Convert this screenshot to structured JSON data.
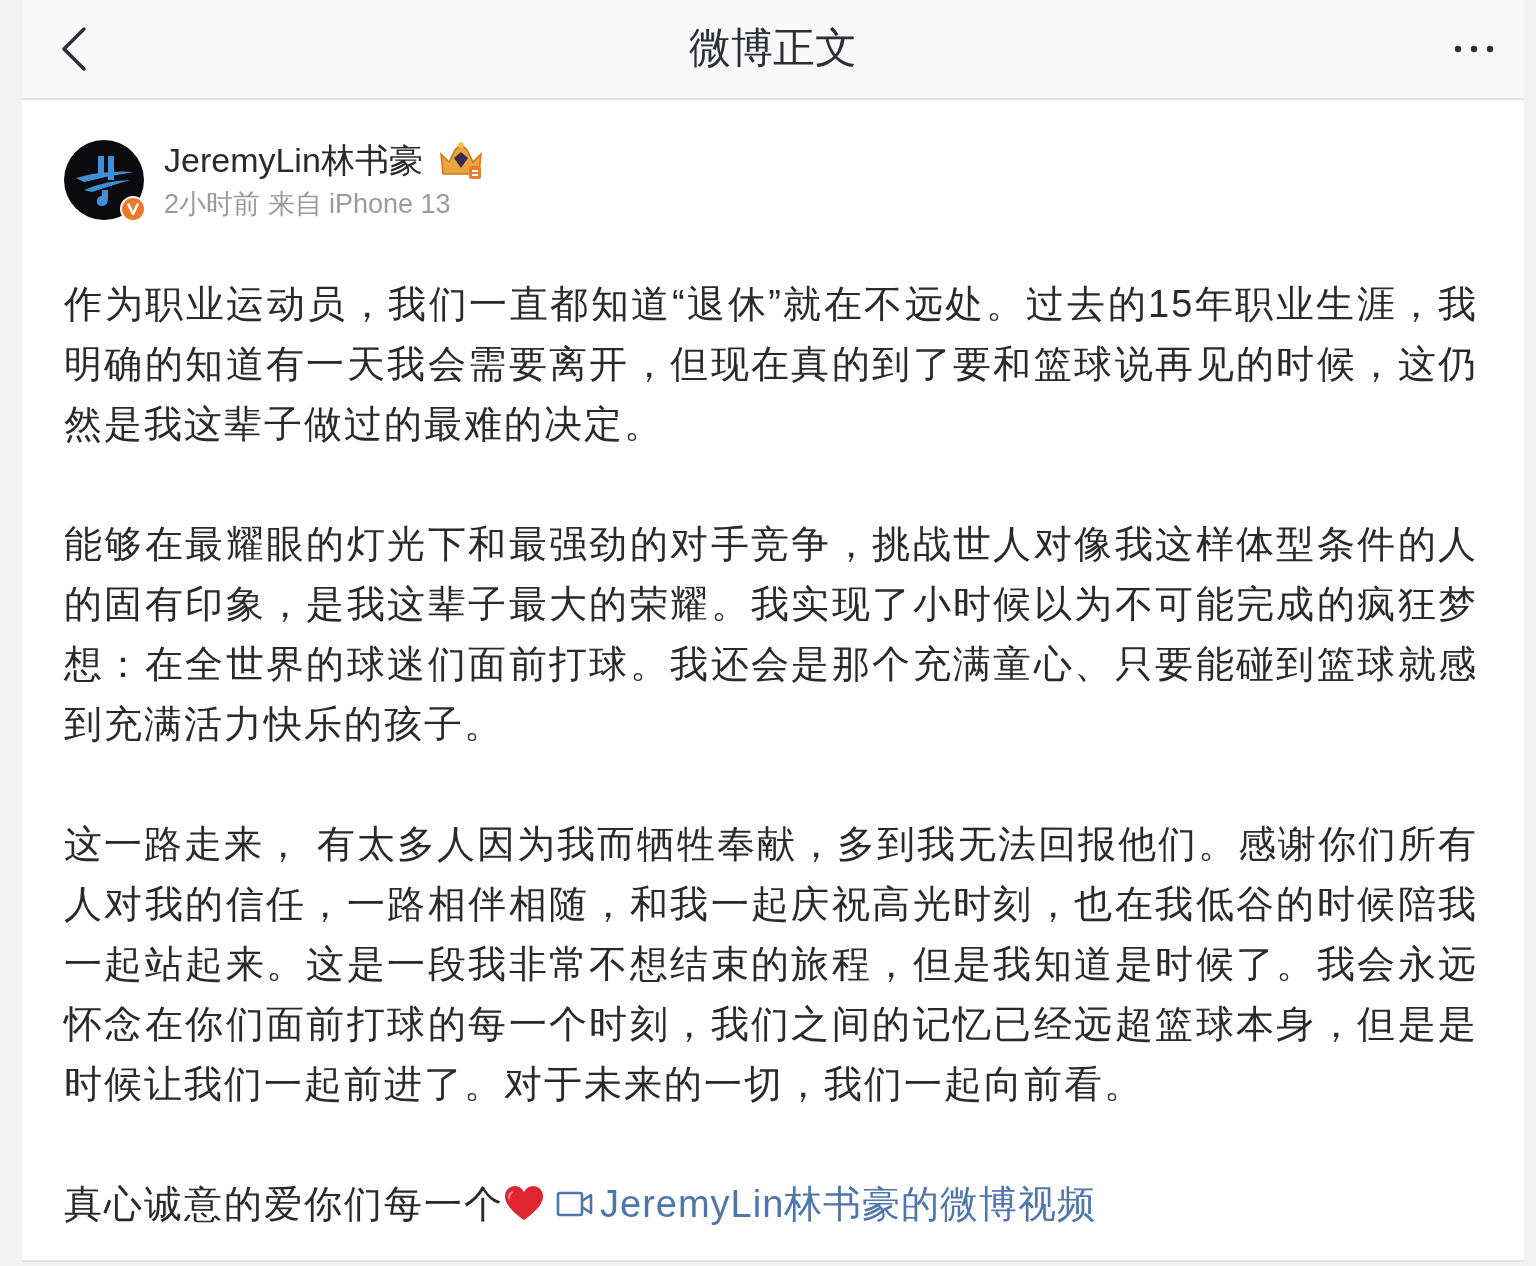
{
  "header": {
    "title": "微博正文"
  },
  "post": {
    "author": {
      "name": "JeremyLin林书豪",
      "verified": true,
      "meta": "2小时前 来自 iPhone 13"
    },
    "paragraphs": [
      "作为职业运动员，我们一直都知道“退休”就在不远处。过去的15年职业生涯，我明确的知道有一天我会需要离开，但现在真的到了要和篮球说再见的时候，这仍然是我这辈子做过的最难的决定。",
      "能够在最耀眼的灯光下和最强劲的对手竞争，挑战世人对像我这样体型条件的人的固有印象，是我这辈子最大的荣耀。我实现了小时候以为不可能完成的疯狂梦想：在全世界的球迷们面前打球。我还会是那个充满童心、只要能碰到篮球就感到充满活力快乐的孩子。",
      "这一路走来， 有太多人因为我而牺牲奉献，多到我无法回报他们。感谢你们所有人对我的信任，一路相伴相随，和我一起庆祝高光时刻，也在我低谷的时候陪我一起站起来。这是一段我非常不想结束的旅程，但是我知道是时候了。我会永远怀念在你们面前打球的每一个时刻，我们之间的记忆已经远超篮球本身，但是是时候让我们一起前进了。对于未来的一切，我们一起向前看。"
    ],
    "closing": {
      "text": "真心诚意的爱你们每一个",
      "link": "JeremyLin林书豪的微博视频"
    }
  }
}
